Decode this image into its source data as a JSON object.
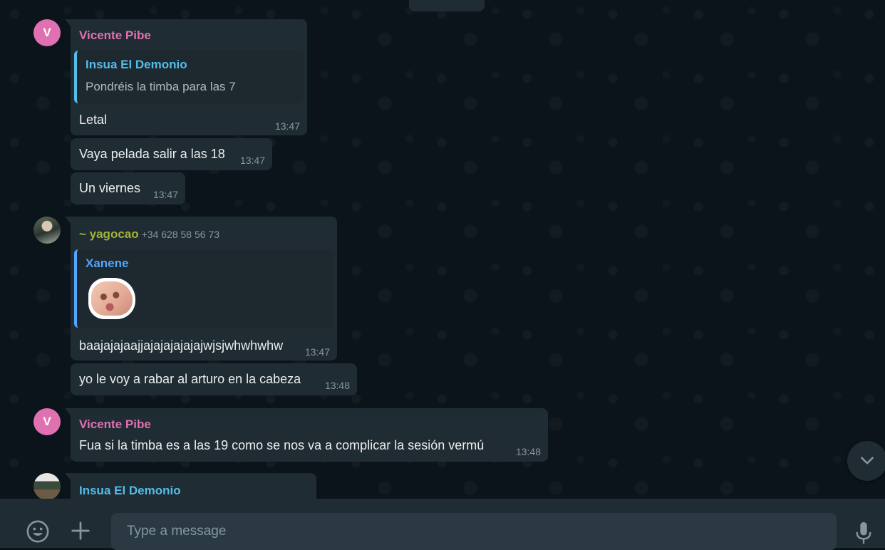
{
  "composer": {
    "placeholder": "Type a message"
  },
  "icons": {
    "emoji": "emoji-icon",
    "attach": "plus-icon",
    "mic": "microphone-icon",
    "scroll": "chevron-down-icon"
  },
  "colors": {
    "vicente": "#e071b1",
    "insua": "#53bdeb",
    "yagocao": "#a5b337",
    "xanene": "#53a6fd"
  },
  "messages": {
    "m1": {
      "avatar_letter": "V",
      "sender": "Vicente Pibe",
      "quote_name": "Insua El Demonio",
      "quote_text": "Pondréis la timba para las 7",
      "text": "Letal",
      "time": "13:47"
    },
    "m2": {
      "text": "Vaya pelada salir a las 18",
      "time": "13:47"
    },
    "m3": {
      "text": "Un viernes",
      "time": "13:47"
    },
    "m4": {
      "sender": "~ yagocao",
      "phone": "+34 628 58 56 73",
      "quote_name": "Xanene",
      "text": "baajajajaajjajajajajajajwjsjwhwhwhw",
      "time": "13:47"
    },
    "m5": {
      "text": "yo le voy a rabar al arturo en la cabeza",
      "time": "13:48"
    },
    "m6": {
      "avatar_letter": "V",
      "sender": "Vicente Pibe",
      "text": "Fua si la timba es a las 19 como se nos va a complicar la sesión vermú",
      "time": "13:48"
    },
    "m7": {
      "sender": "Insua El Demonio"
    }
  }
}
